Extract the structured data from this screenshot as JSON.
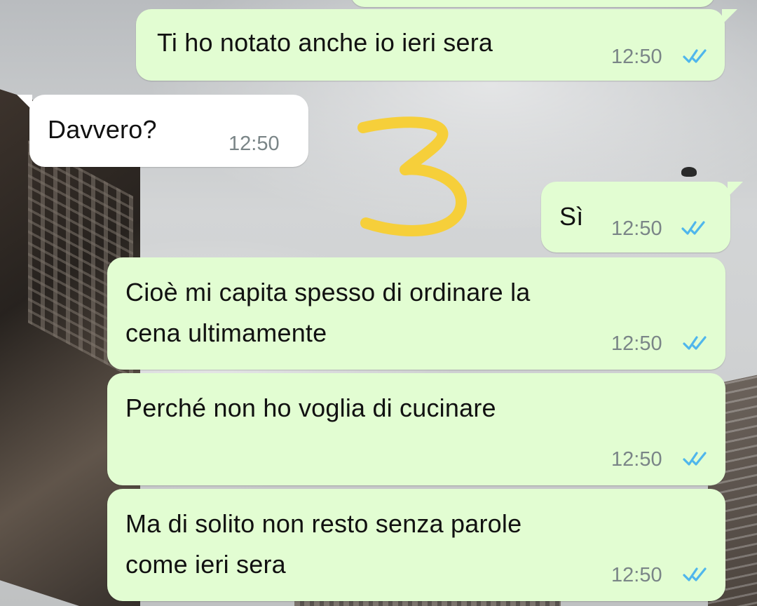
{
  "chat": {
    "messages": [
      {
        "direction": "outgoing",
        "text": "Ti ho notato anche io ieri sera",
        "time": "12:50",
        "status": "read"
      },
      {
        "direction": "incoming",
        "text": "Davvero?",
        "time": "12:50"
      },
      {
        "direction": "outgoing",
        "text": "Sì",
        "time": "12:50",
        "status": "read"
      },
      {
        "direction": "outgoing",
        "lines": [
          "Cioè mi capita spesso di ordinare la",
          "cena ultimamente"
        ],
        "time": "12:50",
        "status": "read"
      },
      {
        "direction": "outgoing",
        "text": "Perché non ho voglia di cucinare",
        "time": "12:50",
        "status": "read"
      },
      {
        "direction": "outgoing",
        "lines": [
          "Ma di solito non resto senza parole",
          "come ieri sera"
        ],
        "time": "12:50",
        "status": "read"
      }
    ]
  },
  "annotation": {
    "text": "3",
    "color": "#f6cf3a"
  },
  "colors": {
    "outgoing_bubble": "#e2fdd2",
    "incoming_bubble": "#ffffff",
    "timestamp": "#7a8587",
    "read_ticks": "#4fb6ec"
  },
  "icons": {
    "read_receipt": "double-check-icon"
  }
}
